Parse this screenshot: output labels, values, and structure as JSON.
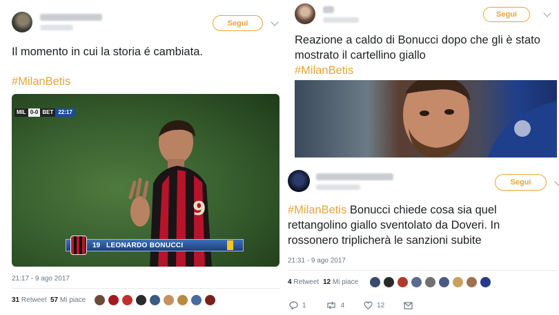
{
  "tweet_left": {
    "follow_label": "Segui",
    "text": "Il momento in cui la storia é cambiata.",
    "hashtag": "#MilanBetis",
    "media": {
      "scorebug": [
        "MIL",
        "0-0",
        "BET",
        "22:17"
      ],
      "player_number": "19",
      "player_name": "LEONARDO BONUCCI"
    },
    "timestamp": "21:17 - 9 ago 2017",
    "retweets_count": "31",
    "retweets_label": "Retweet",
    "likes_count": "57",
    "likes_label": "Mi piace"
  },
  "tweet_right_top": {
    "follow_label": "Segui",
    "text": "Reazione a caldo di Bonucci dopo che gli è stato mostrato il cartellino giallo",
    "hashtag": "#MilanBetis"
  },
  "tweet_right_bottom": {
    "follow_label": "Segui",
    "hashtag": "#MilanBetis",
    "text": " Bonucci chiede cosa sia quel rettangolino giallo sventolato da Doveri. In rossonero triplicherà le sanzioni subite",
    "timestamp": "21:31 - 9 ago 2017",
    "retweets_count": "4",
    "retweets_label": "Retweet",
    "likes_count": "12",
    "likes_label": "Mi piace",
    "reply_count": "1",
    "retweet_action_count": "4",
    "like_action_count": "12"
  },
  "colors": {
    "accent": "#e8a33a",
    "text": "#1c2022",
    "muted": "#657786"
  }
}
